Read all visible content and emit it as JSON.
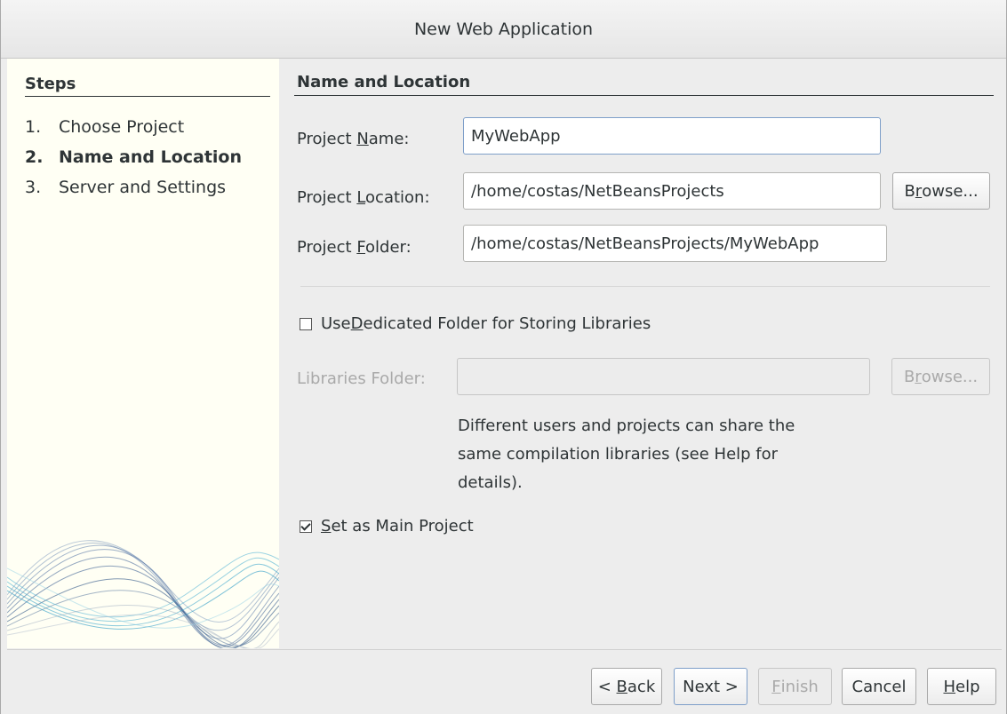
{
  "window": {
    "title": "New Web Application"
  },
  "steps": {
    "title": "Steps",
    "items": [
      {
        "num": "1.",
        "label": "Choose Project",
        "active": false
      },
      {
        "num": "2.",
        "label": "Name and Location",
        "active": true
      },
      {
        "num": "3.",
        "label": "Server and Settings",
        "active": false
      }
    ]
  },
  "section": {
    "title": "Name and Location"
  },
  "form": {
    "project_name": {
      "label_pre": "Project ",
      "label_key": "N",
      "label_post": "ame:",
      "value": "MyWebApp"
    },
    "project_location": {
      "label_pre": "Project ",
      "label_key": "L",
      "label_post": "ocation:",
      "value": "/home/costas/NetBeansProjects"
    },
    "project_folder": {
      "label_pre": "Project ",
      "label_key": "F",
      "label_post": "older:",
      "value": "/home/costas/NetBeansProjects/MyWebApp"
    },
    "browse": {
      "pre": "B",
      "key": "r",
      "post": "owse..."
    },
    "dedicated_folder": {
      "pre": "Use ",
      "key": "D",
      "post": "edicated Folder for Storing Libraries",
      "checked": false
    },
    "libraries_folder": {
      "label": "Libraries Folder:",
      "value": ""
    },
    "hint": "Different users and projects can share the same compilation libraries (see Help for details).",
    "main_project": {
      "key": "S",
      "post": "et as Main Project",
      "checked": true
    }
  },
  "buttons": {
    "back": {
      "pre": "< ",
      "key": "B",
      "post": "ack"
    },
    "next": {
      "label": "Next >"
    },
    "finish": {
      "key": "F",
      "post": "inish"
    },
    "cancel": {
      "label": "Cancel"
    },
    "help": {
      "key": "H",
      "post": "elp"
    }
  }
}
